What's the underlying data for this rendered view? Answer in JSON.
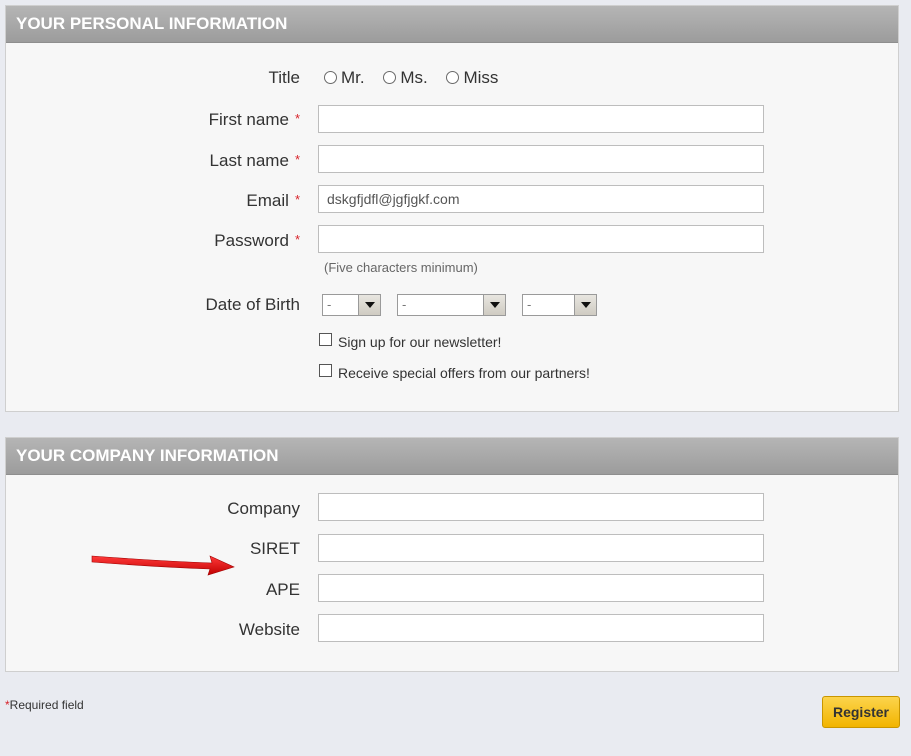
{
  "personal": {
    "header": "YOUR PERSONAL INFORMATION",
    "title_label": "Title",
    "title_options": [
      "Mr.",
      "Ms.",
      "Miss"
    ],
    "first_name_label": "First name",
    "last_name_label": "Last name",
    "email_label": "Email",
    "email_value": "dskgfjdfl@jgfjgkf.com",
    "password_label": "Password",
    "password_hint": "(Five characters minimum)",
    "dob_label": "Date of Birth",
    "dob_day": "-",
    "dob_month": "-",
    "dob_year": "-",
    "newsletter_label": "Sign up for our newsletter!",
    "offers_label": "Receive special offers from our partners!",
    "required_marker": "*"
  },
  "company": {
    "header": "YOUR COMPANY INFORMATION",
    "company_label": "Company",
    "siret_label": "SIRET",
    "ape_label": "APE",
    "website_label": "Website"
  },
  "footer": {
    "required_star": "*",
    "required_text": "Required field",
    "register_label": "Register"
  },
  "colors": {
    "header_bg": "#a8a8a8",
    "required": "#d8222a",
    "register_bg": "#f7c21b",
    "annotation_arrow": "#e01010"
  },
  "icons": {
    "annotation": "red-arrow-icon",
    "select": "dropdown-arrow-icon"
  }
}
